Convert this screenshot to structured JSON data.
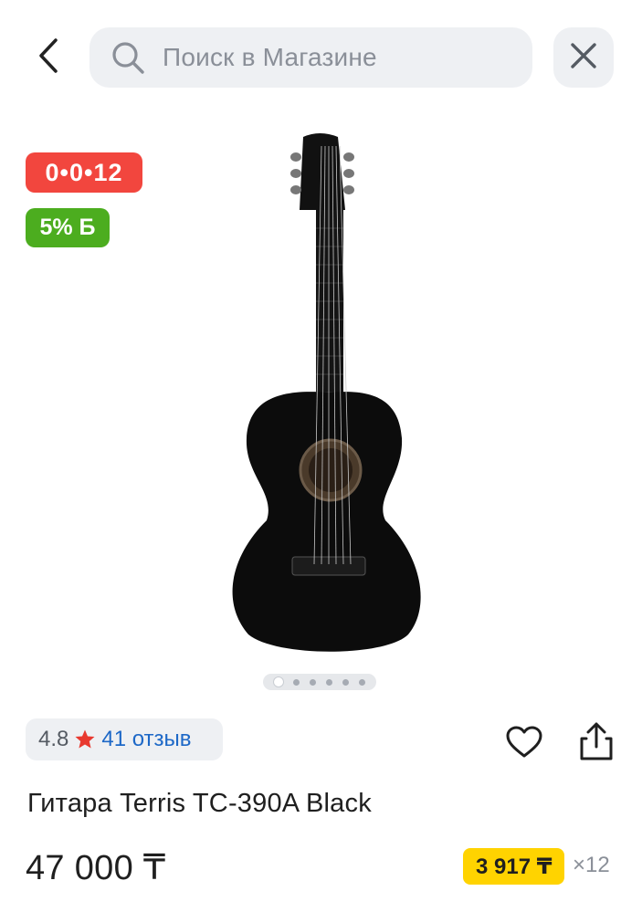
{
  "header": {
    "search_placeholder": "Поиск в Магазине"
  },
  "badges": {
    "installment": "0•0•12",
    "bonus": "5% Б"
  },
  "gallery": {
    "image_count": 6,
    "active_index": 0
  },
  "rating": {
    "value": "4.8",
    "reviews": "41 отзыв"
  },
  "product": {
    "title": "Гитара Terris TC-390A Black",
    "price": "47 000 ₸",
    "monthly_price": "3 917 ₸",
    "months": "×12"
  },
  "colors": {
    "installment_badge": "#f2463e",
    "bonus_badge": "#4cad1f",
    "monthly_badge": "#ffd300",
    "link": "#1d68c7",
    "star": "#e8392f"
  }
}
